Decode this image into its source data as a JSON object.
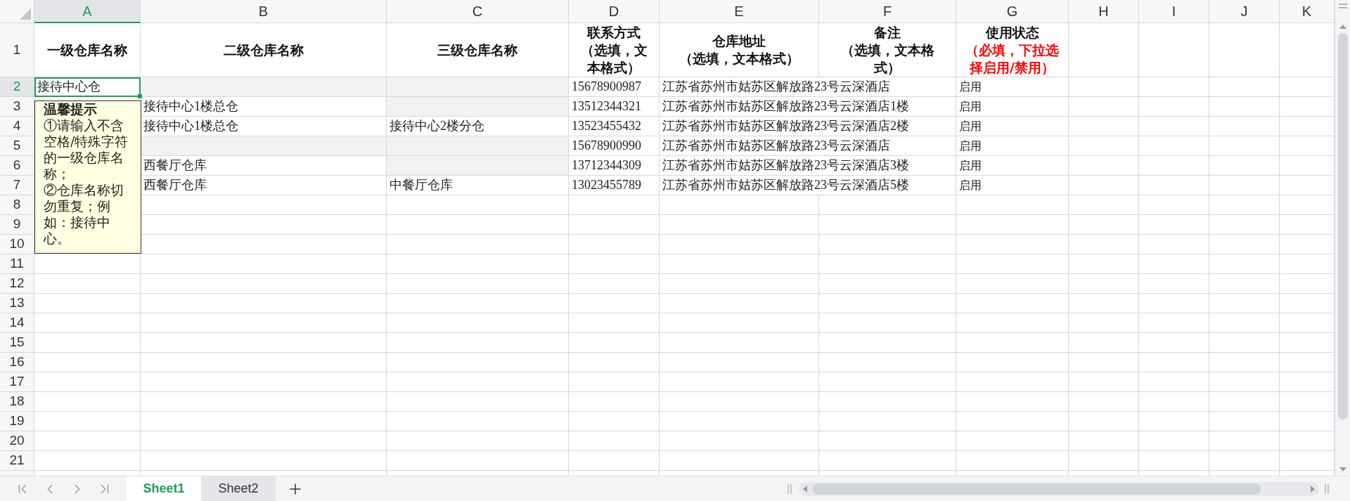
{
  "columns": [
    {
      "label": "A",
      "selected": true
    },
    {
      "label": "B",
      "selected": false
    },
    {
      "label": "C",
      "selected": false
    },
    {
      "label": "D",
      "selected": false
    },
    {
      "label": "E",
      "selected": false
    },
    {
      "label": "F",
      "selected": false
    },
    {
      "label": "G",
      "selected": false
    },
    {
      "label": "H",
      "selected": false
    },
    {
      "label": "I",
      "selected": false
    },
    {
      "label": "J",
      "selected": false
    },
    {
      "label": "K",
      "selected": false
    }
  ],
  "header_row": {
    "label": "1",
    "selected": false,
    "cells": [
      {
        "title": "一级仓库名称"
      },
      {
        "title": "二级仓库名称"
      },
      {
        "title": "三级仓库名称"
      },
      {
        "title": "联系方式",
        "note": "（选填，文本格式）",
        "required": false
      },
      {
        "title": "仓库地址",
        "note": "（选填，文本格式）",
        "required": false
      },
      {
        "title": "备注",
        "note": "（选填，文本格式）",
        "required": false
      },
      {
        "title": "使用状态",
        "note": "（必填，下拉选择启用/禁用）",
        "required": true
      }
    ]
  },
  "rows": [
    {
      "label": "2",
      "selected": true,
      "cells": [
        {
          "text": "接待中心仓",
          "shaded": false
        },
        {
          "shaded": true
        },
        {
          "shaded": true
        },
        {
          "text": "15678900987",
          "shaded": false
        },
        {
          "text": "江苏省苏州市姑苏区解放路23号云深酒店",
          "shaded": false
        },
        {
          "shaded": false
        },
        {
          "text": "启用",
          "shaded": false
        }
      ]
    },
    {
      "label": "3",
      "selected": false,
      "cells": [
        {
          "text": "接待中心1楼总仓",
          "shaded": false
        },
        {
          "shaded": true
        },
        {
          "text": "13512344321",
          "shaded": false
        },
        {
          "text": "江苏省苏州市姑苏区解放路23号云深酒店1楼",
          "shaded": false
        },
        {
          "shaded": false
        },
        {
          "text": "启用",
          "shaded": false
        }
      ]
    },
    {
      "label": "4",
      "selected": false,
      "cells": [
        {
          "text": "接待中心1楼总仓",
          "shaded": false
        },
        {
          "text": "接待中心2楼分仓",
          "shaded": false
        },
        {
          "text": "13523455432",
          "shaded": false
        },
        {
          "text": "江苏省苏州市姑苏区解放路23号云深酒店2楼",
          "shaded": false
        },
        {
          "shaded": false
        },
        {
          "text": "启用",
          "shaded": false
        }
      ]
    },
    {
      "label": "5",
      "selected": false,
      "cells": [
        {
          "shaded": true
        },
        {
          "shaded": true
        },
        {
          "text": "15678900990",
          "shaded": false
        },
        {
          "text": "江苏省苏州市姑苏区解放路23号云深酒店",
          "shaded": false
        },
        {
          "shaded": false
        },
        {
          "text": "启用",
          "shaded": false
        }
      ]
    },
    {
      "label": "6",
      "selected": false,
      "cells": [
        {
          "text": "西餐厅仓库",
          "shaded": false
        },
        {
          "shaded": true
        },
        {
          "text": "13712344309",
          "shaded": false
        },
        {
          "text": "江苏省苏州市姑苏区解放路23号云深酒店3楼",
          "shaded": false
        },
        {
          "shaded": false
        },
        {
          "text": "启用",
          "shaded": false
        }
      ]
    },
    {
      "label": "7",
      "selected": false,
      "cells": [
        {
          "text": "西餐厅仓库",
          "shaded": false
        },
        {
          "text": "中餐厅仓库",
          "shaded": false
        },
        {
          "text": "13023455789",
          "shaded": false
        },
        {
          "text": "江苏省苏州市姑苏区解放路23号云深酒店5楼",
          "shaded": false
        },
        {
          "shaded": false
        },
        {
          "text": "启用",
          "shaded": false
        }
      ]
    },
    {
      "label": "8",
      "selected": false
    },
    {
      "label": "9",
      "selected": false
    },
    {
      "label": "10",
      "selected": false
    },
    {
      "label": "11",
      "selected": false
    },
    {
      "label": "12",
      "selected": false
    },
    {
      "label": "13",
      "selected": false
    },
    {
      "label": "14",
      "selected": false
    },
    {
      "label": "15",
      "selected": false
    },
    {
      "label": "16",
      "selected": false
    },
    {
      "label": "17",
      "selected": false
    },
    {
      "label": "18",
      "selected": false
    },
    {
      "label": "19",
      "selected": false
    },
    {
      "label": "20",
      "selected": false
    },
    {
      "label": "21",
      "selected": false
    }
  ],
  "comment": {
    "title": "温馨提示",
    "lines": [
      "①请输入不含空格/特殊字符的一级仓库名称；",
      "②仓库名称切勿重复；例如：接待中心。"
    ]
  },
  "sheets": [
    {
      "label": "Sheet1",
      "selected": true
    },
    {
      "label": "Sheet2",
      "selected": false
    }
  ]
}
